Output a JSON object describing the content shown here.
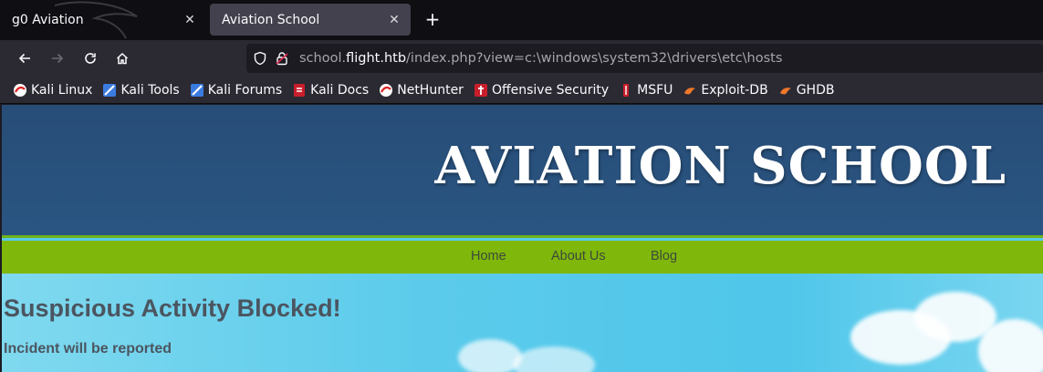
{
  "browser": {
    "tabs": [
      {
        "title": "g0 Aviation",
        "active": false
      },
      {
        "title": "Aviation School",
        "active": true
      }
    ],
    "url": {
      "prefix": "school.",
      "domain": "flight.htb",
      "path": "/index.php?view=c:\\windows\\system32\\drivers\\etc\\hosts"
    },
    "bookmarks": [
      {
        "label": "Kali Linux",
        "icon": "kali-dragon-icon"
      },
      {
        "label": "Kali Tools",
        "icon": "kali-tools-icon"
      },
      {
        "label": "Kali Forums",
        "icon": "kali-forums-icon"
      },
      {
        "label": "Kali Docs",
        "icon": "kali-docs-icon"
      },
      {
        "label": "NetHunter",
        "icon": "nethunter-icon"
      },
      {
        "label": "Offensive Security",
        "icon": "offsec-icon"
      },
      {
        "label": "MSFU",
        "icon": "msfu-icon"
      },
      {
        "label": "Exploit-DB",
        "icon": "exploit-db-icon"
      },
      {
        "label": "GHDB",
        "icon": "ghdb-icon"
      }
    ]
  },
  "site": {
    "title": "AVIATION SCHOOL",
    "menu": [
      "Home",
      "About Us",
      "Blog"
    ],
    "alert_title": "Suspicious Activity Blocked!",
    "alert_subtitle": "Incident will be reported"
  },
  "colors": {
    "header_blue": "#2a5582",
    "menu_green": "#80b70b",
    "sky_blue": "#58c8ea",
    "alert_text": "#4b5560"
  }
}
